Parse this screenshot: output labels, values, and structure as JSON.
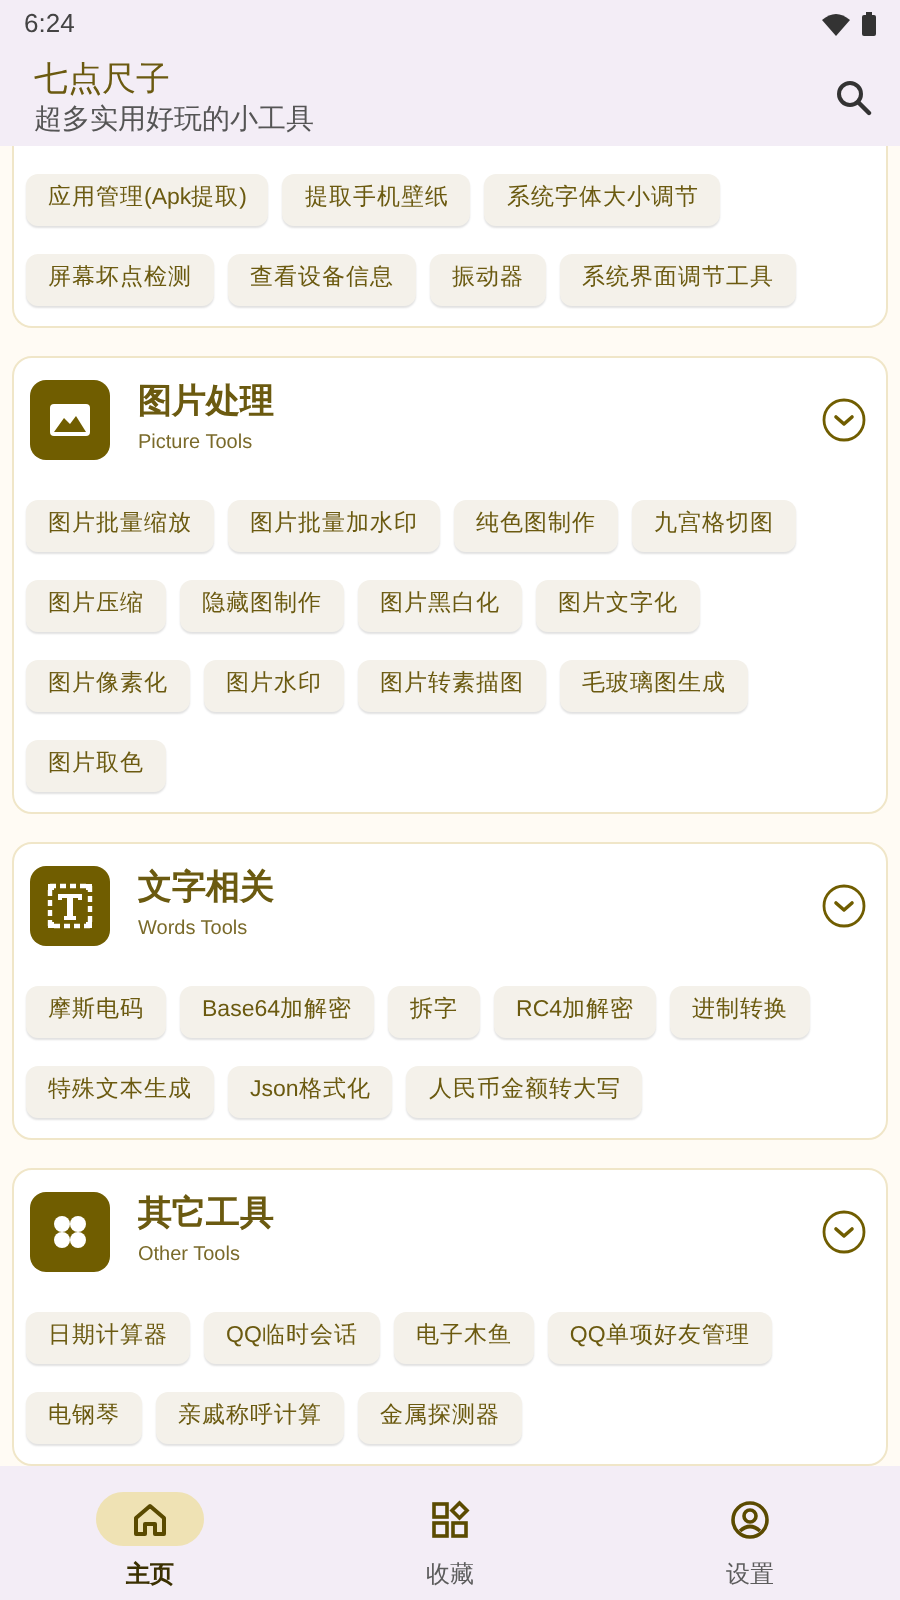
{
  "status_bar": {
    "time": "6:24"
  },
  "app_bar": {
    "title": "七点尺子",
    "subtitle": "超多实用好玩的小工具"
  },
  "sections": [
    {
      "chips": [
        "应用管理(Apk提取)",
        "提取手机壁纸",
        "系统字体大小调节",
        "屏幕坏点检测",
        "查看设备信息",
        "振动器",
        "系统界面调节工具"
      ]
    },
    {
      "title": "图片处理",
      "subtitle": "Picture Tools",
      "chips": [
        "图片批量缩放",
        "图片批量加水印",
        "纯色图制作",
        "九宫格切图",
        "图片压缩",
        "隐藏图制作",
        "图片黑白化",
        "图片文字化",
        "图片像素化",
        "图片水印",
        "图片转素描图",
        "毛玻璃图生成",
        "图片取色"
      ]
    },
    {
      "title": "文字相关",
      "subtitle": "Words Tools",
      "chips": [
        "摩斯电码",
        "Base64加解密",
        "拆字",
        "RC4加解密",
        "进制转换",
        "特殊文本生成",
        "Json格式化",
        "人民币金额转大写"
      ]
    },
    {
      "title": "其它工具",
      "subtitle": "Other Tools",
      "chips": [
        "日期计算器",
        "QQ临时会话",
        "电子木鱼",
        "QQ单项好友管理",
        "电钢琴",
        "亲戚称呼计算",
        "金属探测器"
      ]
    }
  ],
  "nav": [
    {
      "label": "主页",
      "selected": true
    },
    {
      "label": "收藏",
      "selected": false
    },
    {
      "label": "设置",
      "selected": false
    }
  ]
}
